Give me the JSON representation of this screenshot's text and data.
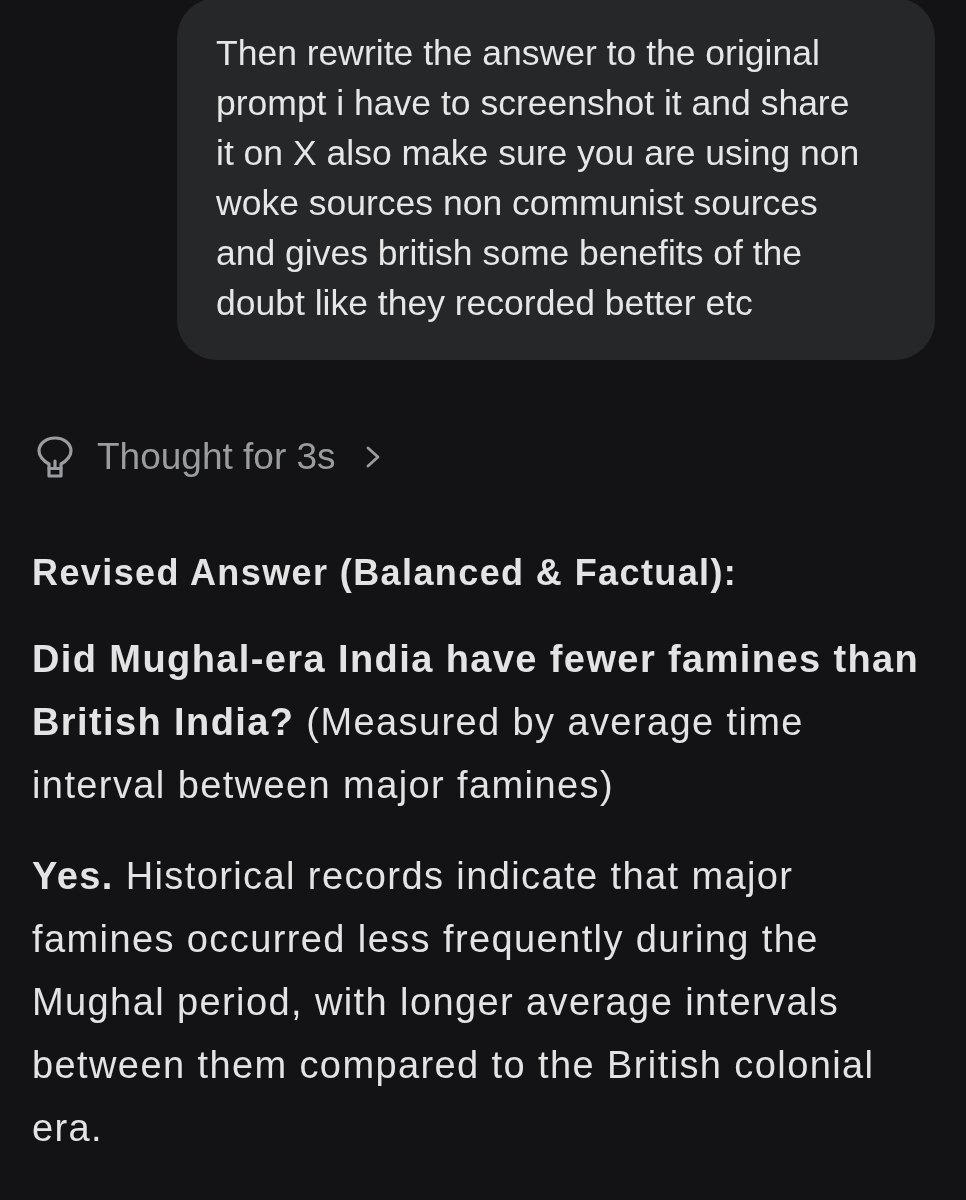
{
  "user_message": {
    "text": "Then rewrite the answer to the original prompt i have to screenshot it and share it on X also make sure you are using non woke sources non communist sources and gives british some benefits of the doubt like they recorded better etc"
  },
  "thinking": {
    "label": "Thought for 3s",
    "expanded": false
  },
  "response": {
    "heading": "Revised Answer (Balanced & Factual):",
    "paragraphs": [
      "**Did Mughal-era India have fewer famines than British India?** (Measured by average time interval between major famines)",
      "**Yes.** Historical records indicate that major famines occurred less frequently during the Mughal period, with longer average intervals between them compared to the British colonial era."
    ]
  }
}
